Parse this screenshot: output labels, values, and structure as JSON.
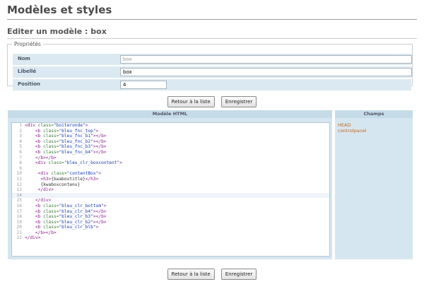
{
  "page": {
    "title": "Modèles et styles",
    "subtitle": "Editer un modèle : box"
  },
  "properties": {
    "legend": "Propriétés",
    "rows": [
      {
        "label": "Nom",
        "value": "box"
      },
      {
        "label": "Libellé",
        "value": "box"
      },
      {
        "label": "Position",
        "value": "4"
      }
    ]
  },
  "buttons": {
    "back": "Retour à la liste",
    "save": "Enregistrer"
  },
  "columns": {
    "template": "Modèle HTML",
    "fields": "Champs"
  },
  "code": [
    [
      {
        "t": "tag",
        "v": "<div "
      },
      {
        "t": "attr",
        "v": "class="
      },
      {
        "t": "str",
        "v": "\"boiteronde\""
      },
      {
        "t": "tag",
        "v": ">"
      }
    ],
    [
      {
        "t": "txt",
        "v": "    "
      },
      {
        "t": "tag",
        "v": "<b "
      },
      {
        "t": "attr",
        "v": "class="
      },
      {
        "t": "str",
        "v": "\"bleu_fnc_top\""
      },
      {
        "t": "tag",
        "v": ">"
      }
    ],
    [
      {
        "t": "txt",
        "v": "    "
      },
      {
        "t": "tag",
        "v": "<b "
      },
      {
        "t": "attr",
        "v": "class="
      },
      {
        "t": "str",
        "v": "\"bleu_fnc_b1\""
      },
      {
        "t": "tag",
        "v": "></b>"
      }
    ],
    [
      {
        "t": "txt",
        "v": "    "
      },
      {
        "t": "tag",
        "v": "<b "
      },
      {
        "t": "attr",
        "v": "class="
      },
      {
        "t": "str",
        "v": "\"bleu_fnc_b2\""
      },
      {
        "t": "tag",
        "v": "></b>"
      }
    ],
    [
      {
        "t": "txt",
        "v": "    "
      },
      {
        "t": "tag",
        "v": "<b "
      },
      {
        "t": "attr",
        "v": "class="
      },
      {
        "t": "str",
        "v": "\"bleu_fnc_b3\""
      },
      {
        "t": "tag",
        "v": "></b>"
      }
    ],
    [
      {
        "t": "txt",
        "v": "    "
      },
      {
        "t": "tag",
        "v": "<b "
      },
      {
        "t": "attr",
        "v": "class="
      },
      {
        "t": "str",
        "v": "\"bleu_fnc_b4\""
      },
      {
        "t": "tag",
        "v": "></b>"
      }
    ],
    [
      {
        "t": "txt",
        "v": "    "
      },
      {
        "t": "tag",
        "v": "</b></b>"
      }
    ],
    [
      {
        "t": "txt",
        "v": "    "
      },
      {
        "t": "tag",
        "v": "<div "
      },
      {
        "t": "attr",
        "v": "class="
      },
      {
        "t": "str",
        "v": "\"bleu_clr_boxcontent\""
      },
      {
        "t": "tag",
        "v": ">"
      }
    ],
    [],
    [
      {
        "t": "txt",
        "v": "     "
      },
      {
        "t": "tag",
        "v": "<div "
      },
      {
        "t": "attr",
        "v": "class="
      },
      {
        "t": "str",
        "v": "\"contentBox\""
      },
      {
        "t": "tag",
        "v": ">"
      }
    ],
    [
      {
        "t": "txt",
        "v": "      "
      },
      {
        "t": "tag",
        "v": "<h3>"
      },
      {
        "t": "txt",
        "v": "{kwaboxtitle}"
      },
      {
        "t": "tag",
        "v": "</h3>"
      }
    ],
    [
      {
        "t": "txt",
        "v": "      {kwaboxcontenu}"
      }
    ],
    [
      {
        "t": "txt",
        "v": "     "
      },
      {
        "t": "tag",
        "v": "</div>"
      }
    ],
    [],
    [
      {
        "t": "txt",
        "v": "    "
      },
      {
        "t": "tag",
        "v": "</div>"
      }
    ],
    [
      {
        "t": "txt",
        "v": "    "
      },
      {
        "t": "tag",
        "v": "<b "
      },
      {
        "t": "attr",
        "v": "class="
      },
      {
        "t": "str",
        "v": "\"bleu_clr_bottom\""
      },
      {
        "t": "tag",
        "v": ">"
      }
    ],
    [
      {
        "t": "txt",
        "v": "    "
      },
      {
        "t": "tag",
        "v": "<b "
      },
      {
        "t": "attr",
        "v": "class="
      },
      {
        "t": "str",
        "v": "\"bleu_clr_b4\""
      },
      {
        "t": "tag",
        "v": "></b>"
      }
    ],
    [
      {
        "t": "txt",
        "v": "    "
      },
      {
        "t": "tag",
        "v": "<b "
      },
      {
        "t": "attr",
        "v": "class="
      },
      {
        "t": "str",
        "v": "\"bleu_clr_b3\""
      },
      {
        "t": "tag",
        "v": "></b>"
      }
    ],
    [
      {
        "t": "txt",
        "v": "    "
      },
      {
        "t": "tag",
        "v": "<b "
      },
      {
        "t": "attr",
        "v": "class="
      },
      {
        "t": "str",
        "v": "\"bleu_clr_b2\""
      },
      {
        "t": "tag",
        "v": "></b>"
      }
    ],
    [
      {
        "t": "txt",
        "v": "    "
      },
      {
        "t": "tag",
        "v": "<b "
      },
      {
        "t": "attr",
        "v": "class="
      },
      {
        "t": "str",
        "v": "\"bleu_clr_blb\""
      },
      {
        "t": "tag",
        "v": ">"
      }
    ],
    [
      {
        "t": "txt",
        "v": "    "
      },
      {
        "t": "tag",
        "v": "</b></b>"
      }
    ],
    [
      {
        "t": "tag",
        "v": "</div>"
      }
    ]
  ],
  "active_line": 14,
  "fields": [
    "HEAD",
    "controlpanel"
  ]
}
